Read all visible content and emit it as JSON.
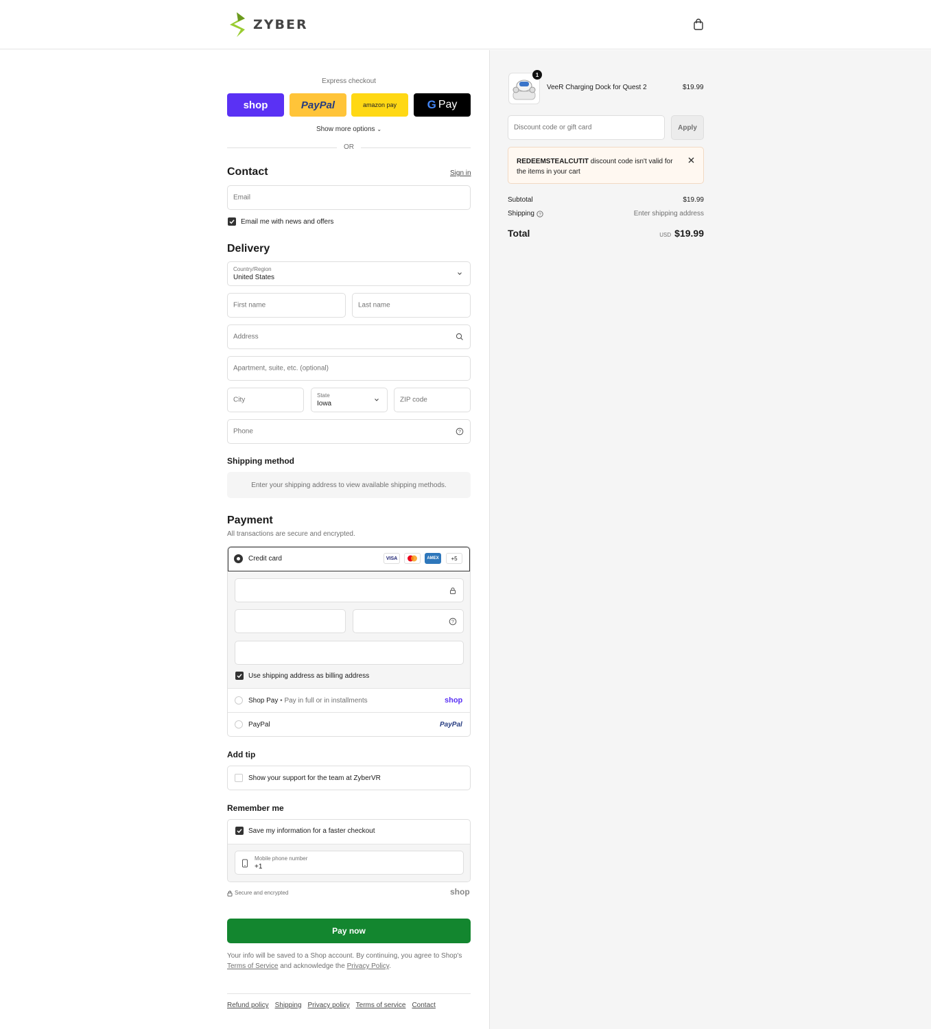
{
  "brand": {
    "name": "ZYBER",
    "accent": "#9ACD32"
  },
  "express": {
    "title": "Express checkout",
    "shop_label": "shop",
    "paypal_label": "PayPal",
    "amazon_label": "amazon pay",
    "gpay_label": "Pay",
    "show_more": "Show more options",
    "or": "OR"
  },
  "contact": {
    "heading": "Contact",
    "sign_in": "Sign in",
    "email_placeholder": "Email",
    "news_label": "Email me with news and offers"
  },
  "delivery": {
    "heading": "Delivery",
    "country_label": "Country/Region",
    "country_value": "United States",
    "first_name": "First name",
    "last_name": "Last name",
    "address": "Address",
    "apartment": "Apartment, suite, etc. (optional)",
    "city": "City",
    "state_label": "State",
    "state_value": "Iowa",
    "zip": "ZIP code",
    "phone": "Phone"
  },
  "shipping_method": {
    "heading": "Shipping method",
    "notice": "Enter your shipping address to view available shipping methods."
  },
  "payment": {
    "heading": "Payment",
    "subtitle": "All transactions are secure and encrypted.",
    "credit_card": "Credit card",
    "visa": "VISA",
    "amex": "AMEX",
    "more_cards": "+5",
    "billing_label": "Use shipping address as billing address",
    "shop_pay": "Shop Pay",
    "shop_pay_desc": "Pay in full or in installments",
    "shop_logo": "shop",
    "paypal": "PayPal",
    "paypal_logo": "PayPal"
  },
  "tip": {
    "heading": "Add tip",
    "label": "Show your support for the team at ZyberVR"
  },
  "remember": {
    "heading": "Remember me",
    "save_label": "Save my information for a faster checkout",
    "mobile_label": "Mobile phone number",
    "mobile_value": "+1",
    "secure": "Secure and encrypted",
    "shop_logo": "shop"
  },
  "pay_now": "Pay now",
  "legal": {
    "line1": "Your info will be saved to a Shop account. By continuing, you agree to Shop's",
    "tos": "Terms of Service",
    "and": "and acknowledge the",
    "privacy": "Privacy Policy",
    "period": "."
  },
  "footer": [
    "Refund policy",
    "Shipping",
    "Privacy policy",
    "Terms of service",
    "Contact"
  ],
  "summary": {
    "product_name": "VeeR Charging Dock for Quest 2",
    "product_price": "$19.99",
    "quantity": "1",
    "discount_placeholder": "Discount code or gift card",
    "apply": "Apply",
    "error_code": "REDEEMSTEALCUTIT",
    "error_msg_1": "discount code isn't valid for",
    "error_msg_2": "the items in your cart",
    "subtotal_label": "Subtotal",
    "subtotal_value": "$19.99",
    "shipping_label": "Shipping",
    "shipping_value": "Enter shipping address",
    "total_label": "Total",
    "currency": "USD",
    "total_value": "$19.99"
  },
  "colors": {
    "shop_purple": "#5A31F4",
    "paypal_yellow": "#FFC439",
    "amazon_yellow": "#FFD814",
    "pay_green": "#13862F",
    "error_bg": "#FFF8F1"
  }
}
